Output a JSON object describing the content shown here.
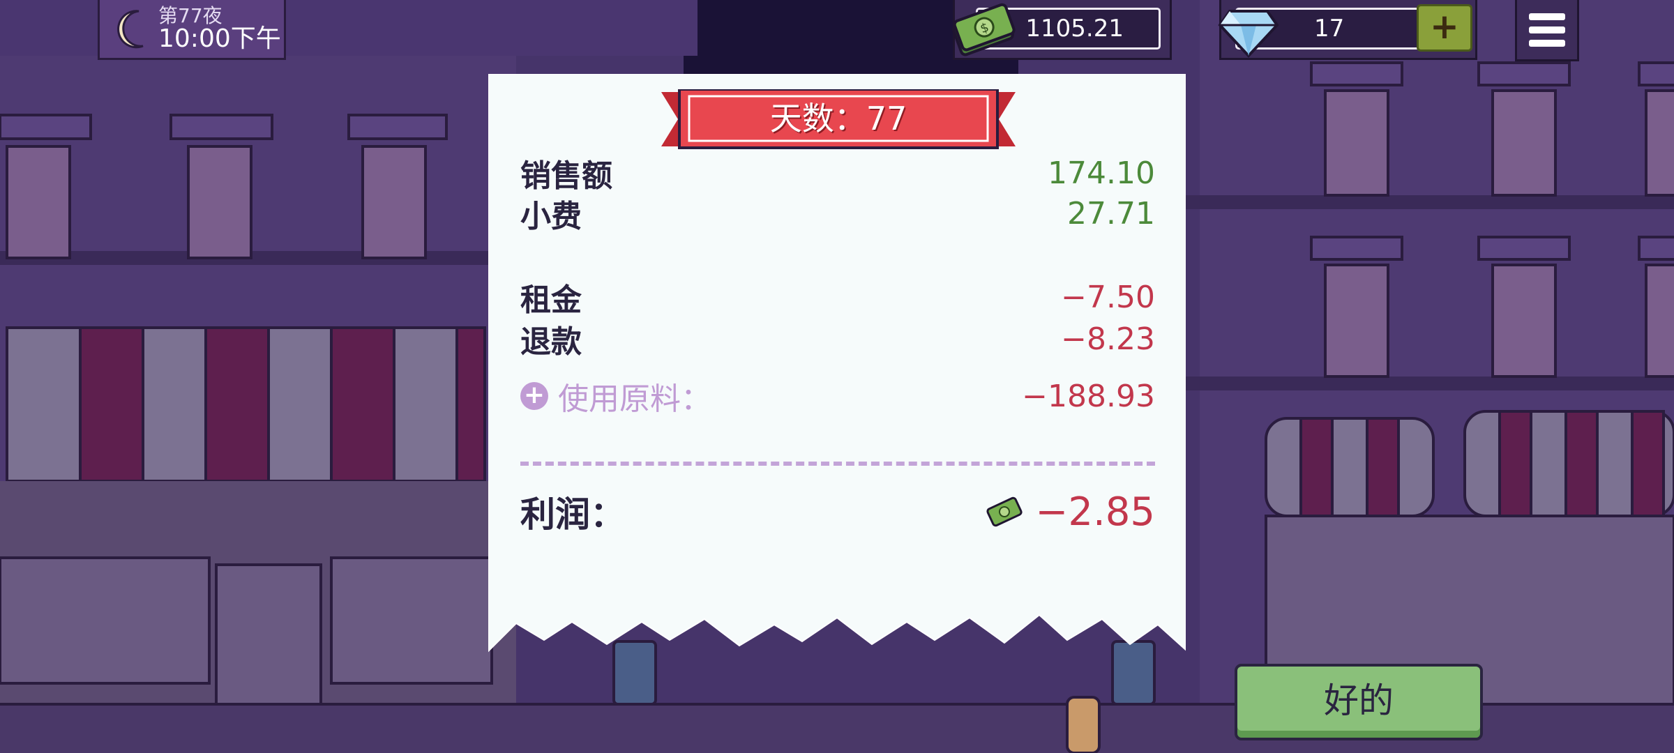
{
  "hud": {
    "night_label": "第77夜",
    "time": "10:00下午",
    "money": "1105.21",
    "gems": "17",
    "plus_label": "+",
    "icons": [
      "moon-icon",
      "cash-icon",
      "diamond-icon",
      "menu-icon"
    ]
  },
  "receipt": {
    "banner": "天数：77",
    "rows": [
      {
        "label": "销售额",
        "value": "174.10"
      },
      {
        "label": "小费",
        "value": "27.71"
      },
      {
        "label": "租金",
        "value": "−7.50"
      },
      {
        "label": "退款",
        "value": "−8.23"
      }
    ],
    "ingredients": {
      "label": "使用原料：",
      "value": "−188.93",
      "icon": "+"
    },
    "profit": {
      "label": "利润：",
      "value": "−2.85"
    }
  },
  "ok_button": "好的",
  "colors": {
    "positive": "#4c8a3a",
    "negative": "#c2374c",
    "banner_red": "#e8474f",
    "button_green": "#8ac07a"
  }
}
